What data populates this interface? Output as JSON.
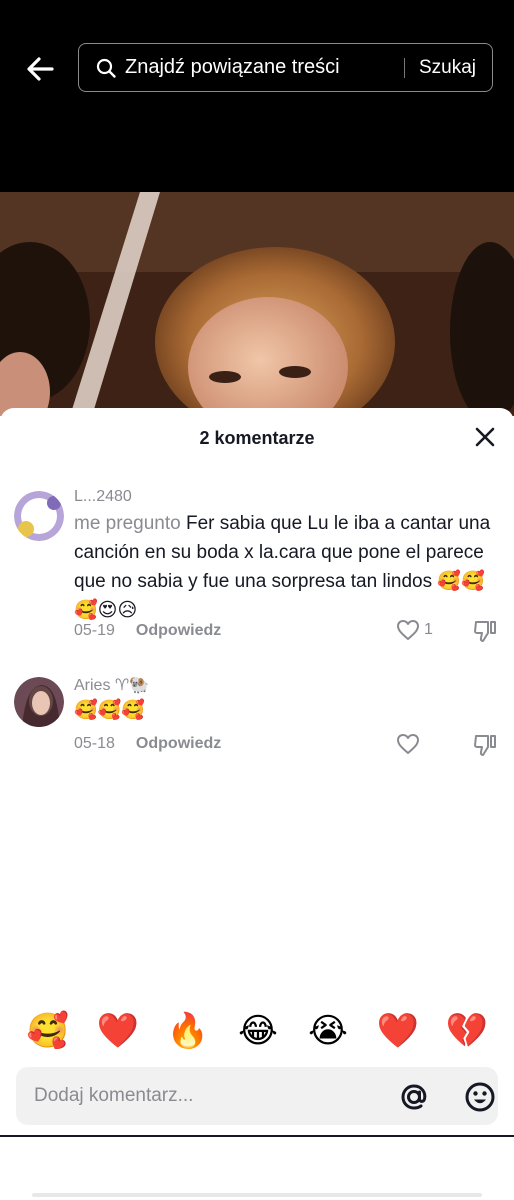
{
  "header": {
    "search_placeholder": "Znajdź powiązane treści",
    "search_button": "Szukaj"
  },
  "comments_panel": {
    "title": "2 komentarze",
    "comments": [
      {
        "username": "L...2480",
        "text_prefix": "me pregunto",
        "text": " Fer sabia que Lu le iba a cantar una canción en su boda x la.cara que pone el parece que no sabia y fue una sorpresa tan lindos 🥰🥰🥰😍😥",
        "date": "05-19",
        "reply": "Odpowiedz",
        "likes": "1"
      },
      {
        "username": "Aries ♈🐏",
        "text": "🥰🥰🥰",
        "date": "05-18",
        "reply": "Odpowiedz",
        "likes": ""
      }
    ]
  },
  "quick_emojis": [
    "🥰",
    "❤️",
    "🔥",
    "😂",
    "😭",
    "❤️",
    "💔"
  ],
  "comment_input": {
    "placeholder": "Dodaj komentarz..."
  },
  "colors": {
    "top_bar": "#000000",
    "text_primary": "#161823",
    "text_secondary": "#8a8b91",
    "input_bg": "#f1f1f2"
  }
}
